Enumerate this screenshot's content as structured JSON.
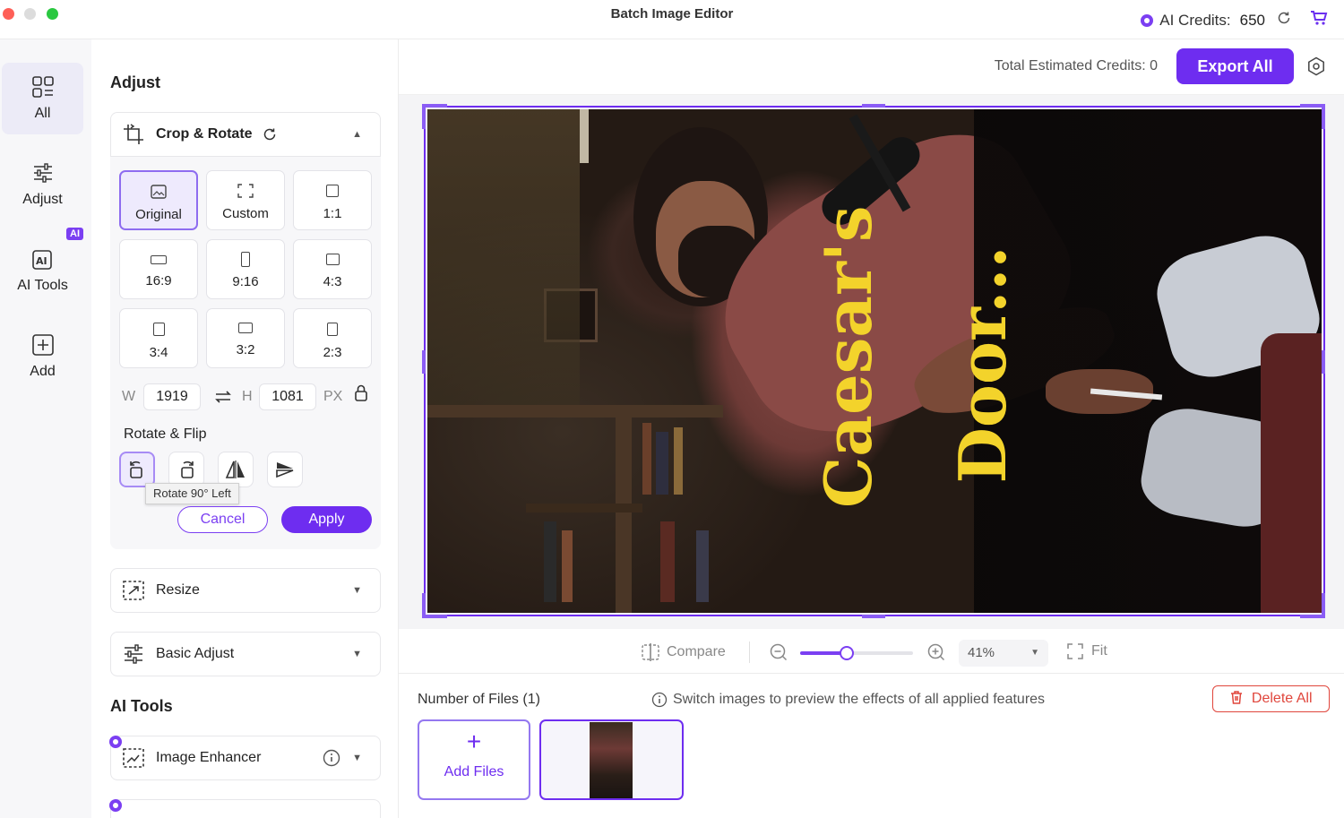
{
  "app": {
    "title": "Batch Image Editor"
  },
  "header": {
    "credits_label": "AI Credits:",
    "credits_value": "650"
  },
  "rail": {
    "items": [
      {
        "label": "All",
        "icon": "grid-icon",
        "active": true
      },
      {
        "label": "Adjust",
        "icon": "sliders-icon",
        "active": false
      },
      {
        "label": "AI Tools",
        "icon": "ai-icon",
        "badge": "AI",
        "active": false
      },
      {
        "label": "Add",
        "icon": "plus-square-icon",
        "active": false
      }
    ]
  },
  "panel": {
    "adjust_title": "Adjust",
    "crop": {
      "title": "Crop & Rotate",
      "ratios": [
        {
          "label": "Original",
          "selected": true
        },
        {
          "label": "Custom"
        },
        {
          "label": "1:1"
        },
        {
          "label": "16:9"
        },
        {
          "label": "9:16"
        },
        {
          "label": "4:3"
        },
        {
          "label": "3:4"
        },
        {
          "label": "3:2"
        },
        {
          "label": "2:3"
        }
      ],
      "w_label": "W",
      "width": "1919",
      "h_label": "H",
      "height": "1081",
      "unit": "PX",
      "rotate_title": "Rotate & Flip",
      "tooltip": "Rotate 90° Left",
      "cancel": "Cancel",
      "apply": "Apply"
    },
    "resize": "Resize",
    "basic_adjust": "Basic Adjust",
    "ai_tools_title": "AI Tools",
    "image_enhancer": "Image Enhancer"
  },
  "main": {
    "total_credits": "Total Estimated Credits: 0",
    "export": "Export All",
    "photo_text_1": "Caesar's",
    "photo_text_2": "Door...",
    "compare": "Compare",
    "zoom": "41%",
    "zoom_fraction": 0.41,
    "fit": "Fit",
    "files_count": "Number of Files (1)",
    "hint": "Switch images to preview the effects of all applied features",
    "delete_all": "Delete All",
    "add_files": "Add Files"
  },
  "colors": {
    "accent": "#6e2df0",
    "danger": "#e0463c"
  }
}
